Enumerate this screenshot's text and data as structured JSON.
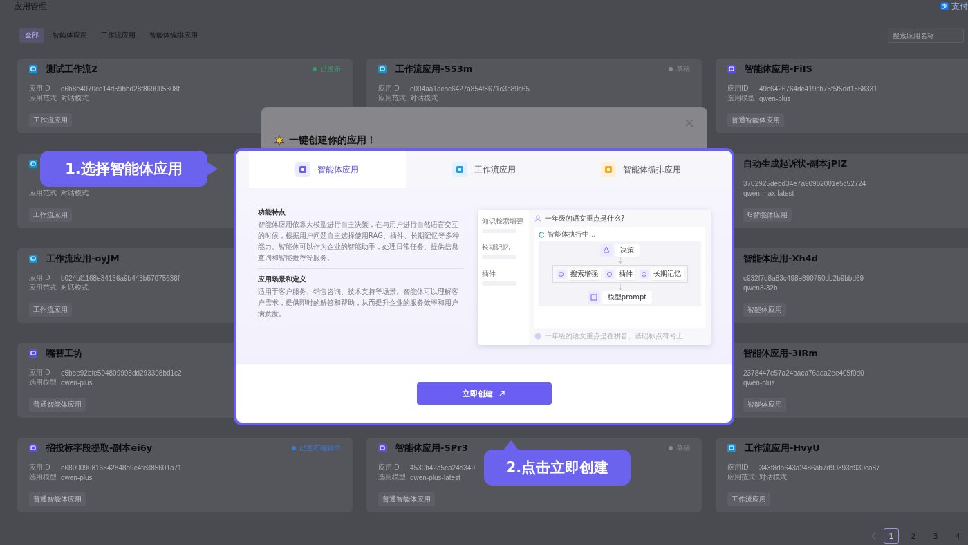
{
  "header": {
    "title": "应用管理",
    "account": "支付"
  },
  "tabs": [
    {
      "label": "全部",
      "selected": true
    },
    {
      "label": "智能体应用",
      "selected": false
    },
    {
      "label": "工作流应用",
      "selected": false
    },
    {
      "label": "智能体编排应用",
      "selected": false
    }
  ],
  "search": {
    "placeholder": "搜索应用名称"
  },
  "card_columns": [
    [
      {
        "kind": "workflow",
        "title": "测试工作流2",
        "status": {
          "label": "已发布",
          "color": "#3a9a6a"
        },
        "meta": [
          {
            "label": "应用ID",
            "value": "d6b8e4070cd14d59bbd28f869005308f"
          },
          {
            "label": "应用范式",
            "value": "对话模式"
          }
        ],
        "tag": "工作流应用"
      },
      {
        "kind": "workflow",
        "meta": [
          {
            "label": "应用范式",
            "value": "对话模式"
          }
        ],
        "tag": "工作流应用"
      },
      {
        "kind": "workflow",
        "title": "工作流应用-oyJM",
        "meta": [
          {
            "label": "应用ID",
            "value": "b024bf1168e34136a9b443b57075638f"
          },
          {
            "label": "应用范式",
            "value": "对话模式"
          }
        ],
        "tag": "工作流应用"
      },
      {
        "kind": "agent",
        "title": "嘴替工坊",
        "meta": [
          {
            "label": "应用ID",
            "value": "e5bee92bfe594809993dd293398bd1c2"
          },
          {
            "label": "选用模型",
            "value": "qwen-plus"
          }
        ],
        "tag": "普通智能体应用"
      },
      {
        "kind": "agent",
        "title": "招投标字段提取-副本ei6y",
        "status": {
          "label": "已发布编辑中",
          "color": "#3b7bd6"
        },
        "meta": [
          {
            "label": "应用ID",
            "value": "e6890090816542848a9c4fe385601a71"
          },
          {
            "label": "选用模型",
            "value": "qwen-plus"
          }
        ],
        "tag": "普通智能体应用"
      }
    ],
    [
      {
        "kind": "workflow",
        "title": "工作流应用-S53m",
        "status": {
          "label": "草稿",
          "color": "#8a8a92"
        },
        "meta": [
          {
            "label": "应用ID",
            "value": "e004aa1acbc6427a854f8671c3b89c65"
          },
          {
            "label": "应用范式",
            "value": "对话模式"
          }
        ]
      },
      {
        "kind": "agent",
        "title": "智能体应用-SPr3",
        "status": {
          "label": "草稿",
          "color": "#8a8a92"
        },
        "meta": [
          {
            "label": "应用ID",
            "value": "4530b42a5ca24d349"
          },
          {
            "label": "选用模型",
            "value": "qwen-plus-latest"
          }
        ],
        "tag": "普通智能体应用"
      }
    ],
    [
      {
        "kind": "agent",
        "title": "智能体应用-FiIS",
        "meta": [
          {
            "label": "应用ID",
            "value": "49c6426764dc419cb75f5f5dd1568331"
          },
          {
            "label": "选用模型",
            "value": "qwen-plus"
          }
        ],
        "tag": "普通智能体应用"
      },
      {
        "covered": true,
        "title": "自动生成起诉状-副本jPlZ",
        "meta": [
          {
            "value": "3702925debd34e7a90982001e5c52724"
          },
          {
            "value": "qwen-max-latest"
          }
        ],
        "tag": "G智能体应用"
      },
      {
        "covered": true,
        "title": "智能体应用-Xh4d",
        "meta": [
          {
            "value": "c932f7d8a83c498e890750db2b9bbd69"
          },
          {
            "value": "qwen3-32b"
          }
        ],
        "tag": "智能体应用"
      },
      {
        "covered": true,
        "title": "智能体应用-3IRm",
        "meta": [
          {
            "value": "2378447e57a24baca76aea2ee405f0d0"
          },
          {
            "value": "qwen-plus"
          }
        ],
        "tag": "智能体应用"
      },
      {
        "kind": "workflow",
        "title": "工作流应用-HvyU",
        "meta": [
          {
            "label": "应用ID",
            "value": "343f8db643a2486ab7d90393d939ca87"
          },
          {
            "label": "应用范式",
            "value": "对话模式"
          }
        ],
        "tag": "工作流应用"
      }
    ]
  ],
  "pagination": {
    "prev_disabled": true,
    "pages": [
      {
        "label": "1",
        "selected": true
      },
      {
        "label": "2",
        "selected": false
      },
      {
        "label": "3",
        "selected": false
      },
      {
        "label": "4",
        "selected": false
      }
    ]
  },
  "modal": {
    "title": "一键创建你的应用！",
    "panel": {
      "tabs": [
        {
          "kind": "agent",
          "label": "智能体应用",
          "selected": true
        },
        {
          "kind": "workflow",
          "label": "工作流应用",
          "selected": false
        },
        {
          "kind": "orchestration",
          "label": "智能体编排应用",
          "selected": false
        }
      ],
      "sections": [
        {
          "heading": "功能特点",
          "text": "智能体应用依靠大模型进行自主决策，在与用户进行自然语言交互的时候，根据用户问题自主选择使用RAG、插件、长期记忆等多种能力。智能体可以作为企业的智能助手，处理日常任务、提供信息查询和智能推荐等服务。"
        },
        {
          "heading": "应用场景和定义",
          "text": "适用于客户服务、销售咨询、技术支持等场景。智能体可以理解客户需求，提供即时的解答和帮助，从而提升企业的服务效率和用户满意度。"
        }
      ],
      "illustration": {
        "sidebar": [
          "知识检索增强",
          "长期记忆",
          "插件"
        ],
        "question": "一年级的语文重点是什么?",
        "status": "智能体执行中...",
        "decision": "决策",
        "tools": [
          "搜索增强",
          "插件",
          "长期记忆"
        ],
        "model": "模型prompt",
        "answer": "一年级的语文重点是在拼音、基础标点符号上"
      },
      "create_button": "立即创建"
    }
  },
  "callouts": {
    "select_step": "1.选择智能体应用",
    "create_step": "2.点击立即创建"
  }
}
